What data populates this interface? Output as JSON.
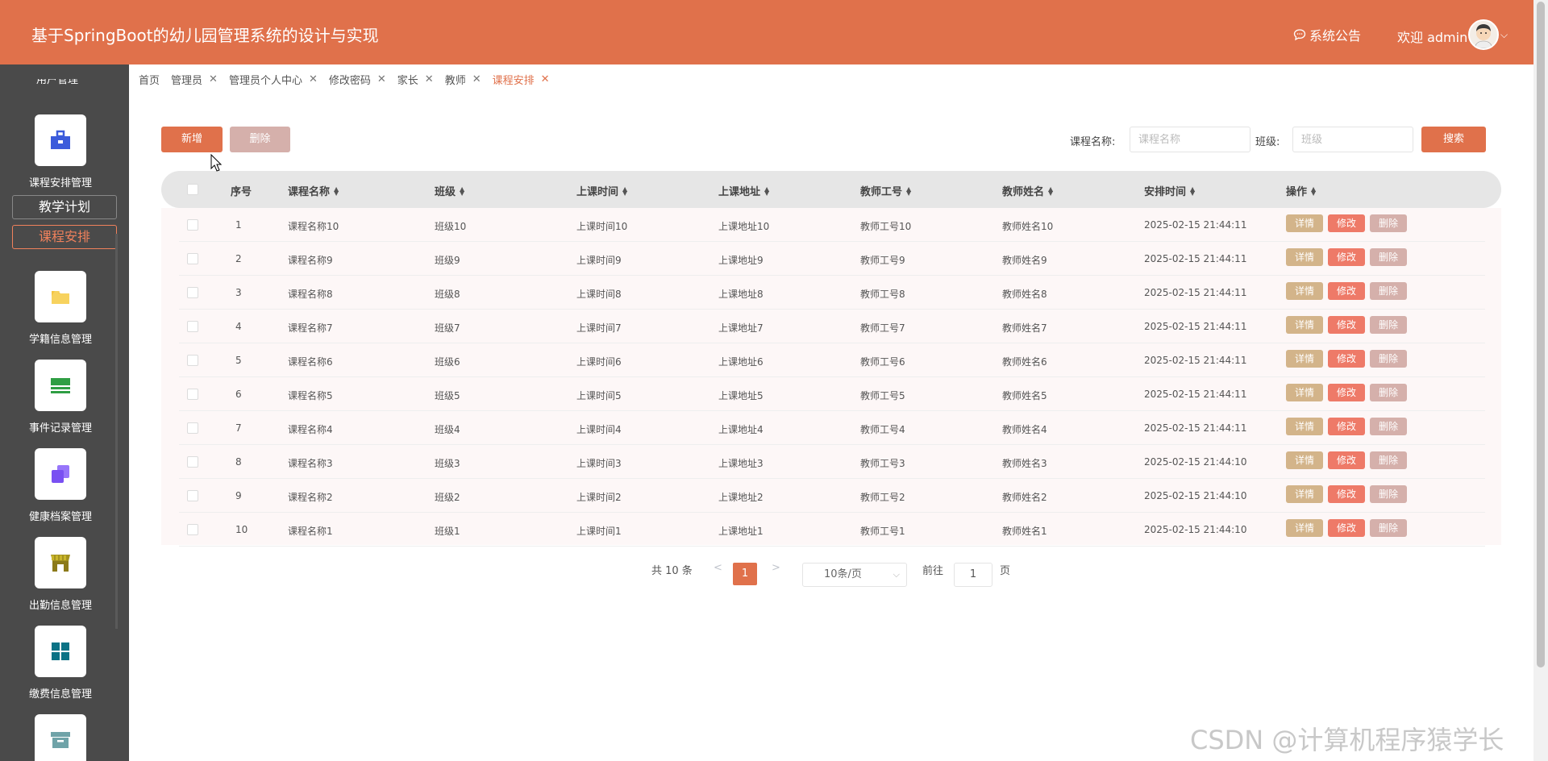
{
  "header": {
    "title": "基于SpringBoot的幼儿园管理系统的设计与实现",
    "notice": "系统公告",
    "welcome": "欢迎 admin"
  },
  "sidebar": {
    "cut_label": "用户管理",
    "groups": [
      {
        "label": "课程安排管理",
        "icon": "toolbox-icon",
        "color": "#3b5bdb"
      },
      {
        "label": "学籍信息管理",
        "icon": "folder-icon",
        "color": "#f5c542"
      },
      {
        "label": "事件记录管理",
        "icon": "list-icon",
        "color": "#2f9e44"
      },
      {
        "label": "健康档案管理",
        "icon": "copy-icon",
        "color": "#7950f2"
      },
      {
        "label": "出勤信息管理",
        "icon": "store-icon",
        "color": "#8c7a1a"
      },
      {
        "label": "缴费信息管理",
        "icon": "grid-icon",
        "color": "#0b7285"
      },
      {
        "label": "",
        "icon": "archive-icon",
        "color": "#6fa3a8"
      }
    ],
    "sub_items": [
      "教学计划",
      "课程安排"
    ]
  },
  "tabs": [
    {
      "label": "首页",
      "closable": false
    },
    {
      "label": "管理员",
      "closable": true
    },
    {
      "label": "管理员个人中心",
      "closable": true
    },
    {
      "label": "修改密码",
      "closable": true
    },
    {
      "label": "家长",
      "closable": true
    },
    {
      "label": "教师",
      "closable": true
    },
    {
      "label": "课程安排",
      "closable": true,
      "active": true
    }
  ],
  "toolbar": {
    "add_label": "新增",
    "delete_label": "删除",
    "course_label": "课程名称:",
    "course_placeholder": "课程名称",
    "class_label": "班级:",
    "class_placeholder": "班级",
    "search_label": "搜索"
  },
  "table": {
    "columns": [
      "序号",
      "课程名称",
      "班级",
      "上课时间",
      "上课地址",
      "教师工号",
      "教师姓名",
      "安排时间",
      "操作"
    ],
    "rows": [
      [
        "1",
        "课程名称10",
        "班级10",
        "上课时间10",
        "上课地址10",
        "教师工号10",
        "教师姓名10",
        "2025-02-15 21:44:11"
      ],
      [
        "2",
        "课程名称9",
        "班级9",
        "上课时间9",
        "上课地址9",
        "教师工号9",
        "教师姓名9",
        "2025-02-15 21:44:11"
      ],
      [
        "3",
        "课程名称8",
        "班级8",
        "上课时间8",
        "上课地址8",
        "教师工号8",
        "教师姓名8",
        "2025-02-15 21:44:11"
      ],
      [
        "4",
        "课程名称7",
        "班级7",
        "上课时间7",
        "上课地址7",
        "教师工号7",
        "教师姓名7",
        "2025-02-15 21:44:11"
      ],
      [
        "5",
        "课程名称6",
        "班级6",
        "上课时间6",
        "上课地址6",
        "教师工号6",
        "教师姓名6",
        "2025-02-15 21:44:11"
      ],
      [
        "6",
        "课程名称5",
        "班级5",
        "上课时间5",
        "上课地址5",
        "教师工号5",
        "教师姓名5",
        "2025-02-15 21:44:11"
      ],
      [
        "7",
        "课程名称4",
        "班级4",
        "上课时间4",
        "上课地址4",
        "教师工号4",
        "教师姓名4",
        "2025-02-15 21:44:11"
      ],
      [
        "8",
        "课程名称3",
        "班级3",
        "上课时间3",
        "上课地址3",
        "教师工号3",
        "教师姓名3",
        "2025-02-15 21:44:10"
      ],
      [
        "9",
        "课程名称2",
        "班级2",
        "上课时间2",
        "上课地址2",
        "教师工号2",
        "教师姓名2",
        "2025-02-15 21:44:10"
      ],
      [
        "10",
        "课程名称1",
        "班级1",
        "上课时间1",
        "上课地址1",
        "教师工号1",
        "教师姓名1",
        "2025-02-15 21:44:10"
      ]
    ],
    "actions": [
      "详情",
      "修改",
      "删除"
    ]
  },
  "pagination": {
    "total": "共 10 条",
    "prev": "<",
    "current": "1",
    "next": ">",
    "page_size": "10条/页",
    "goto_label": "前往",
    "goto_value": "1",
    "page_suffix": "页"
  },
  "watermark": "CSDN @计算机程序猿学长",
  "colors": {
    "primary": "#e0714b",
    "sidebar": "#4a4a4a",
    "detail": "#d3b48a",
    "edit": "#ee7a68",
    "remove": "#d5b0ab"
  }
}
